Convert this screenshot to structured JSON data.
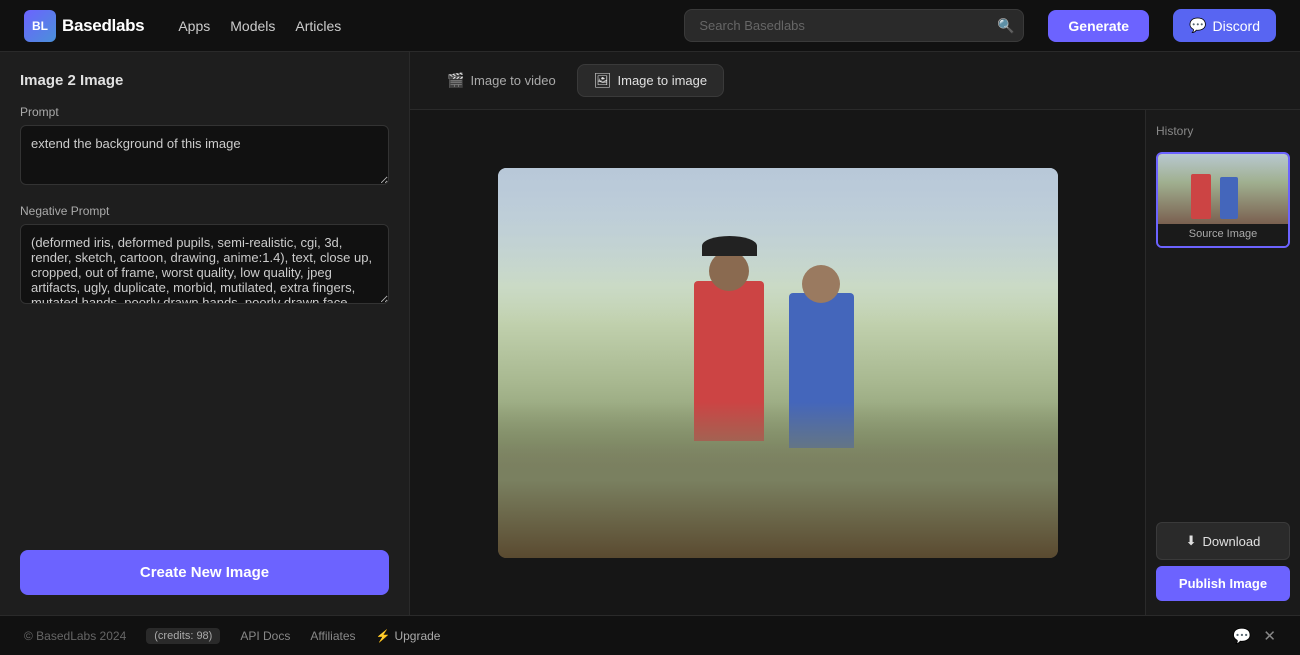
{
  "header": {
    "logo_text": "Basedlabs",
    "nav": [
      {
        "label": "Apps",
        "href": "#"
      },
      {
        "label": "Models",
        "href": "#"
      },
      {
        "label": "Articles",
        "href": "#"
      }
    ],
    "search_placeholder": "Search Basedlabs",
    "generate_label": "Generate",
    "discord_label": "Discord"
  },
  "left_panel": {
    "title": "Image 2 Image",
    "prompt_label": "Prompt",
    "prompt_value": "extend the background of this image",
    "negative_prompt_label": "Negative Prompt",
    "negative_prompt_value": "(deformed iris, deformed pupils, semi-realistic, cgi, 3d, render, sketch, cartoon, drawing, anime:1.4), text, close up, cropped, out of frame, worst quality, low quality, jpeg artifacts, ugly, duplicate, morbid, mutilated, extra fingers, mutated hands, poorly drawn hands, poorly drawn face, mutation, deformed, blurry, dehydrated, bad anatomy, bad proportions",
    "create_btn_label": "Create New Image"
  },
  "tabs": [
    {
      "label": "Image to video",
      "icon": "🎬",
      "active": false
    },
    {
      "label": "Image to image",
      "icon": "🖼",
      "active": true
    }
  ],
  "history": {
    "title": "History",
    "items": [
      {
        "label": "Source Image"
      }
    ]
  },
  "actions": {
    "download_label": "Download",
    "publish_label": "Publish Image",
    "download_icon": "⬇"
  },
  "footer": {
    "copyright": "© BasedLabs 2024",
    "credits": "(credits: 98)",
    "api_docs": "API Docs",
    "affiliates": "Affiliates",
    "upgrade_icon": "⚡",
    "upgrade_label": "Upgrade",
    "discord_icon": "💬",
    "twitter_icon": "✕"
  }
}
